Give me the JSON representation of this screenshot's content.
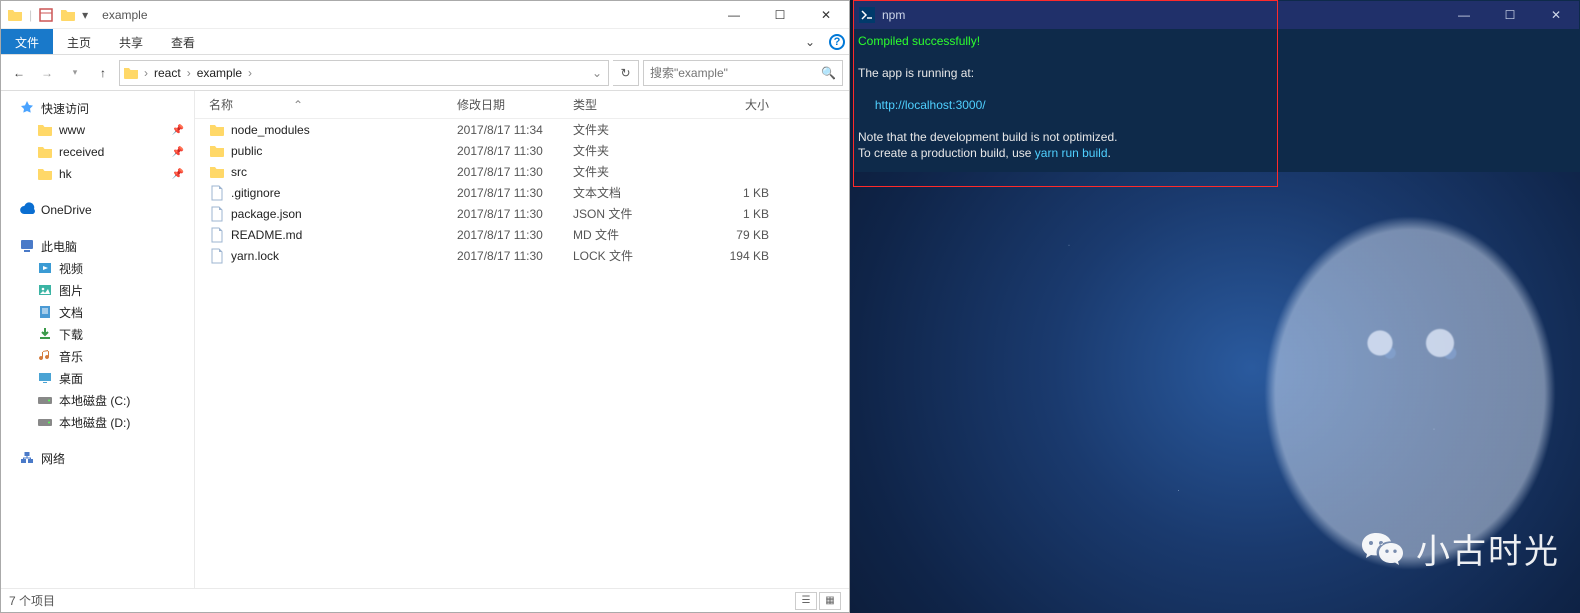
{
  "explorer": {
    "title": "example",
    "ribbon": {
      "file": "文件",
      "home": "主页",
      "share": "共享",
      "view": "查看"
    },
    "path": {
      "segments": [
        "react",
        "example"
      ]
    },
    "search_placeholder": "搜索\"example\"",
    "nav": {
      "quick": {
        "label": "快速访问",
        "items": [
          {
            "label": "www",
            "pinned": true
          },
          {
            "label": "received",
            "pinned": true
          },
          {
            "label": "hk",
            "pinned": true
          }
        ]
      },
      "onedrive": "OneDrive",
      "thispc": {
        "label": "此电脑",
        "items": [
          "视频",
          "图片",
          "文档",
          "下载",
          "音乐",
          "桌面",
          "本地磁盘 (C:)",
          "本地磁盘 (D:)"
        ]
      },
      "network": "网络"
    },
    "columns": {
      "name": "名称",
      "date": "修改日期",
      "type": "类型",
      "size": "大小"
    },
    "rows": [
      {
        "icon": "folder",
        "name": "node_modules",
        "date": "2017/8/17 11:34",
        "type": "文件夹",
        "size": ""
      },
      {
        "icon": "folder",
        "name": "public",
        "date": "2017/8/17 11:30",
        "type": "文件夹",
        "size": ""
      },
      {
        "icon": "folder",
        "name": "src",
        "date": "2017/8/17 11:30",
        "type": "文件夹",
        "size": ""
      },
      {
        "icon": "file",
        "name": ".gitignore",
        "date": "2017/8/17 11:30",
        "type": "文本文档",
        "size": "1 KB"
      },
      {
        "icon": "file",
        "name": "package.json",
        "date": "2017/8/17 11:30",
        "type": "JSON 文件",
        "size": "1 KB"
      },
      {
        "icon": "file",
        "name": "README.md",
        "date": "2017/8/17 11:30",
        "type": "MD 文件",
        "size": "79 KB"
      },
      {
        "icon": "file",
        "name": "yarn.lock",
        "date": "2017/8/17 11:30",
        "type": "LOCK 文件",
        "size": "194 KB"
      }
    ],
    "status": "7 个项目"
  },
  "terminal": {
    "title": "npm",
    "lines": {
      "compiled": "Compiled successfully!",
      "running": "The app is running at:",
      "url": "http://localhost:3000/",
      "note1": "Note that the development build is not optimized.",
      "note2a": "To create a production build, use ",
      "note2b": "yarn run build",
      "note2c": "."
    }
  },
  "watermark": "小古时光"
}
